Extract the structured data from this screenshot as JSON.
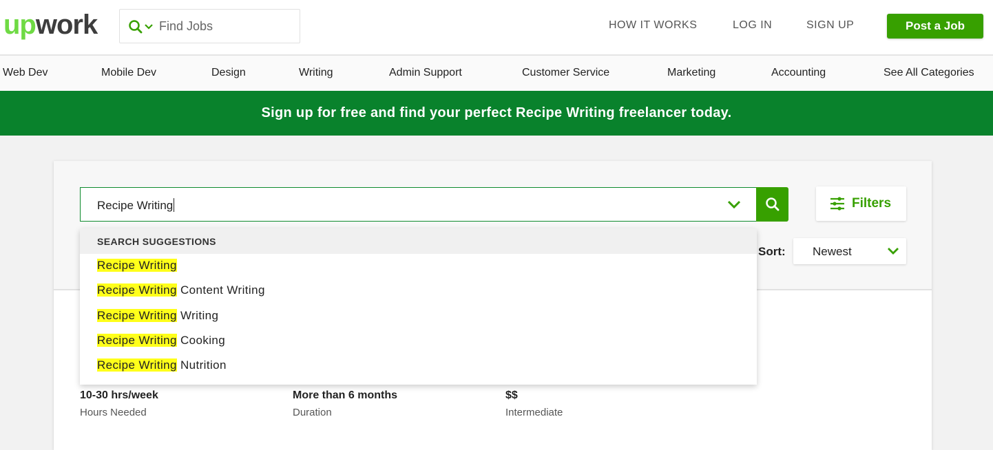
{
  "header": {
    "logo_up": "up",
    "logo_work": "work",
    "find_jobs_placeholder": "Find Jobs",
    "nav": [
      "HOW IT WORKS",
      "LOG IN",
      "SIGN UP"
    ],
    "post_job": "Post a Job"
  },
  "categories": [
    "Web Dev",
    "Mobile Dev",
    "Design",
    "Writing",
    "Admin Support",
    "Customer Service",
    "Marketing",
    "Accounting",
    "See All Categories"
  ],
  "banner": "Sign up for free and find your perfect Recipe Writing freelancer today.",
  "search": {
    "value": "Recipe Writing",
    "filters_label": "Filters",
    "sort_label": "Sort:",
    "sort_value": "Newest"
  },
  "suggestions": {
    "header": "SEARCH SUGGESTIONS",
    "items": [
      {
        "match": "Recipe Writing",
        "rest": ""
      },
      {
        "match": "Recipe Writing",
        "rest": " Content Writing"
      },
      {
        "match": "Recipe Writing",
        "rest": " Writing"
      },
      {
        "match": "Recipe Writing",
        "rest": " Cooking"
      },
      {
        "match": "Recipe Writing",
        "rest": " Nutrition"
      }
    ]
  },
  "job_details": [
    {
      "value": "10-30 hrs/week",
      "label": "Hours Needed"
    },
    {
      "value": "More than 6 months",
      "label": "Duration"
    },
    {
      "value": "$$",
      "label": "Intermediate"
    }
  ],
  "colors": {
    "brand_green": "#37a000",
    "banner_green": "#09822c",
    "logo_green": "#6fda44",
    "highlight": "#ffff1a"
  }
}
